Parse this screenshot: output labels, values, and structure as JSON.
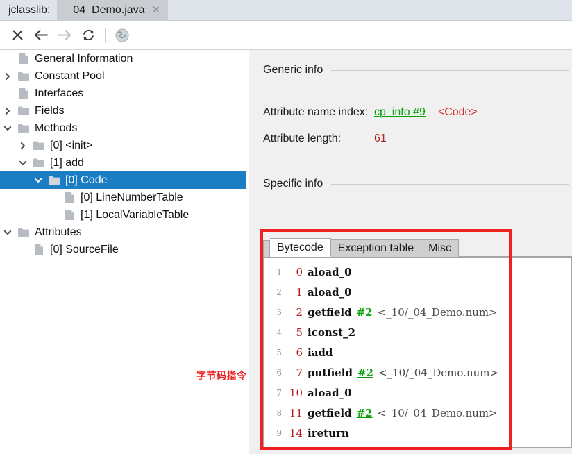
{
  "window": {
    "app_label": "jclasslib:",
    "tab_title": "_04_Demo.java",
    "tab_close": "✕"
  },
  "toolbar": {
    "buttons": [
      {
        "name": "close-icon",
        "glyph": "✕",
        "enabled": true
      },
      {
        "name": "back-arrow-icon",
        "glyph": "←",
        "enabled": true
      },
      {
        "name": "forward-arrow-icon",
        "glyph": "→",
        "enabled": false
      },
      {
        "name": "reload-icon",
        "glyph": "↻",
        "enabled": true
      },
      {
        "name": "browse-globe-icon",
        "glyph": "ἱ0",
        "enabled": false
      }
    ]
  },
  "tree": {
    "nodes": [
      {
        "label": "General Information",
        "indent": 1,
        "twist": "none",
        "icon": "file",
        "selected": false
      },
      {
        "label": "Constant Pool",
        "indent": 1,
        "twist": "collapsed",
        "icon": "folder",
        "selected": false
      },
      {
        "label": "Interfaces",
        "indent": 1,
        "twist": "none",
        "icon": "file",
        "selected": false
      },
      {
        "label": "Fields",
        "indent": 1,
        "twist": "collapsed",
        "icon": "folder",
        "selected": false
      },
      {
        "label": "Methods",
        "indent": 1,
        "twist": "expanded",
        "icon": "folder",
        "selected": false
      },
      {
        "label": "[0] <init>",
        "indent": 2,
        "twist": "collapsed",
        "icon": "folder",
        "selected": false
      },
      {
        "label": "[1] add",
        "indent": 2,
        "twist": "expanded",
        "icon": "folder",
        "selected": false
      },
      {
        "label": "[0] Code",
        "indent": 3,
        "twist": "expanded",
        "icon": "folder",
        "selected": true
      },
      {
        "label": "[0] LineNumberTable",
        "indent": 4,
        "twist": "none",
        "icon": "file",
        "selected": false
      },
      {
        "label": "[1] LocalVariableTable",
        "indent": 4,
        "twist": "none",
        "icon": "file",
        "selected": false
      },
      {
        "label": "Attributes",
        "indent": 1,
        "twist": "expanded",
        "icon": "folder",
        "selected": false
      },
      {
        "label": "[0] SourceFile",
        "indent": 2,
        "twist": "none",
        "icon": "file",
        "selected": false
      }
    ]
  },
  "detail": {
    "generic_info": {
      "section_title": "Generic info",
      "rows": [
        {
          "key": "Attribute name index:",
          "link": "cp_info #9",
          "accent": "<Code>",
          "number": null
        },
        {
          "key": "Attribute length:",
          "link": null,
          "accent": null,
          "number": "61"
        }
      ]
    },
    "specific_info": {
      "section_title": "Specific info",
      "tabs": [
        {
          "label": "Bytecode",
          "active": true
        },
        {
          "label": "Exception table",
          "active": false
        },
        {
          "label": "Misc",
          "active": false
        }
      ]
    }
  },
  "bytecode": [
    {
      "line": "1",
      "offset": "0",
      "opcode": "aload_0",
      "ref": null,
      "comment": null
    },
    {
      "line": "2",
      "offset": "1",
      "opcode": "aload_0",
      "ref": null,
      "comment": null
    },
    {
      "line": "3",
      "offset": "2",
      "opcode": "getfield",
      "ref": "#2",
      "comment": "<_10/_04_Demo.num>"
    },
    {
      "line": "4",
      "offset": "5",
      "opcode": "iconst_2",
      "ref": null,
      "comment": null
    },
    {
      "line": "5",
      "offset": "6",
      "opcode": "iadd",
      "ref": null,
      "comment": null
    },
    {
      "line": "6",
      "offset": "7",
      "opcode": "putfield",
      "ref": "#2",
      "comment": "<_10/_04_Demo.num>"
    },
    {
      "line": "7",
      "offset": "10",
      "opcode": "aload_0",
      "ref": null,
      "comment": null
    },
    {
      "line": "8",
      "offset": "11",
      "opcode": "getfield",
      "ref": "#2",
      "comment": "<_10/_04_Demo.num>"
    },
    {
      "line": "9",
      "offset": "14",
      "opcode": "ireturn",
      "ref": null,
      "comment": null
    }
  ],
  "annotation": {
    "note_text": "字节码指令",
    "box_color": "#ef2020"
  },
  "colors": {
    "selection_blue": "#1b7dc4",
    "link_green": "#05a005",
    "accent_red": "#cf2a2a",
    "number_red": "#b32222",
    "panel_gray": "#f0f0f0"
  }
}
